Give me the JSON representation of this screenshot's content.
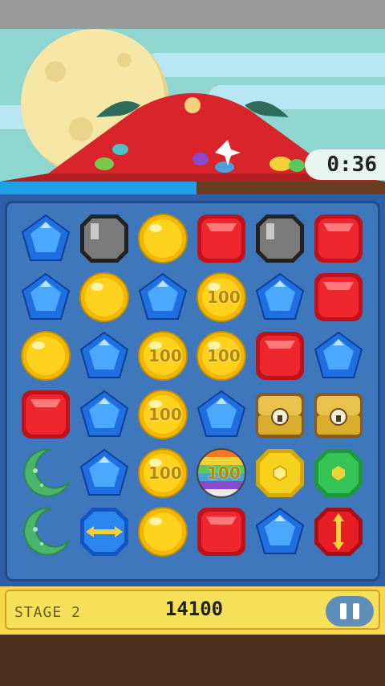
{
  "timer": {
    "label": "0:36"
  },
  "progress": {
    "fraction": 0.51,
    "fill_color": "#1e9fe6"
  },
  "board": {
    "rows": [
      [
        "blue-pentagon",
        "gray-block",
        "yellow-ball",
        "red-gem",
        "gray-block",
        "red-gem"
      ],
      [
        "blue-pentagon",
        "yellow-ball",
        "blue-pentagon",
        "yellow-ball",
        "blue-pentagon",
        "red-gem"
      ],
      [
        "yellow-ball",
        "blue-pentagon",
        "yellow-ball",
        "yellow-ball",
        "red-gem",
        "blue-pentagon"
      ],
      [
        "red-gem",
        "blue-pentagon",
        "yellow-ball",
        "blue-pentagon",
        "treasure-chest",
        "treasure-chest"
      ],
      [
        "green-moon",
        "blue-pentagon",
        "yellow-ball",
        "rainbow-ball",
        "yellow-octagon",
        "green-octagon"
      ],
      [
        "green-moon",
        "blue-arrow-gem",
        "yellow-ball",
        "red-gem",
        "blue-pentagon",
        "red-arrow-gem"
      ]
    ],
    "bonus_labels": [
      {
        "row": 1,
        "col": 3,
        "text": "100"
      },
      {
        "row": 2,
        "col": 2,
        "text": "100"
      },
      {
        "row": 2,
        "col": 3,
        "text": "100"
      },
      {
        "row": 3,
        "col": 2,
        "text": "100"
      },
      {
        "row": 4,
        "col": 2,
        "text": "100"
      },
      {
        "row": 4,
        "col": 3,
        "text": "100"
      }
    ]
  },
  "hud": {
    "stage_label": "STAGE 2",
    "score": "14100"
  }
}
